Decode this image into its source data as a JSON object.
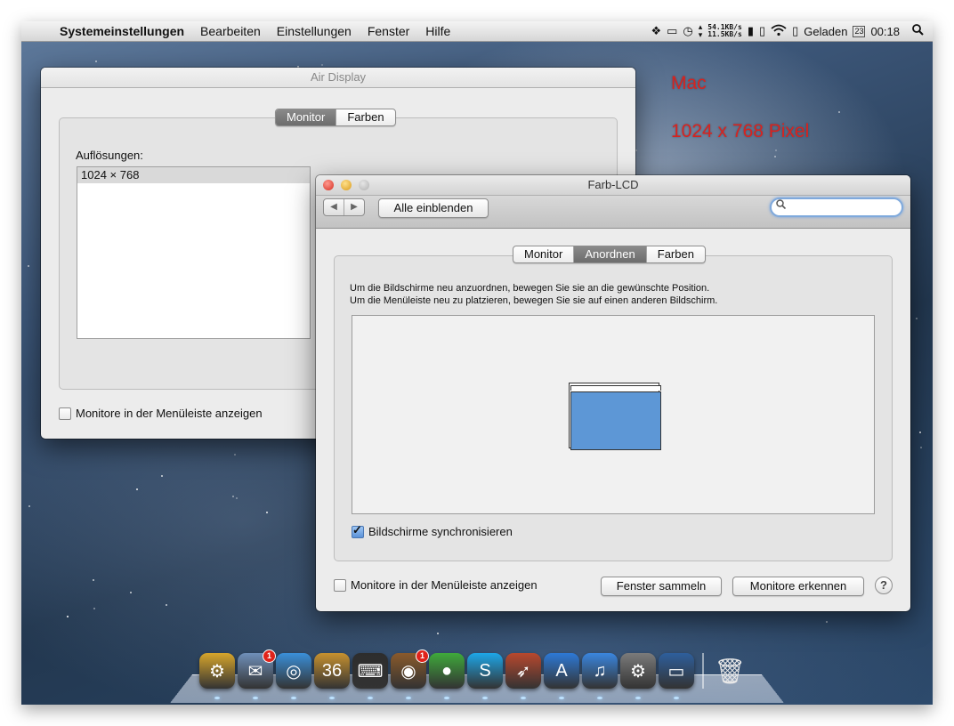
{
  "menubar": {
    "app_name": "Systemeinstellungen",
    "items": [
      "Bearbeiten",
      "Einstellungen",
      "Fenster",
      "Hilfe"
    ],
    "net_up": "54.1KB/s",
    "net_down": "11.5KB/s",
    "battery_label": "Geladen",
    "calendar_day": "23",
    "clock": "00:18",
    "status_icons": [
      "dropbox-icon",
      "airdisplay-icon",
      "timemachine-icon",
      "updown-icon",
      "memory-icon",
      "wifi-icon",
      "battery-icon",
      "spotlight-icon"
    ]
  },
  "desktop": {
    "label_mac": "Mac",
    "label_resolution": "1024 x 768 Pixel",
    "text_color": "#d8231f"
  },
  "air_display": {
    "title": "Air Display",
    "tabs": [
      "Monitor",
      "Farben"
    ],
    "selected_tab": "Monitor",
    "resolutions_label": "Auflösungen:",
    "resolutions": [
      "1024 × 768"
    ],
    "menubar_checkbox_label": "Monitore in der Menüleiste anzeigen"
  },
  "farb_lcd": {
    "title": "Farb-LCD",
    "show_all_label": "Alle einblenden",
    "search_placeholder": "",
    "tabs": [
      "Monitor",
      "Anordnen",
      "Farben"
    ],
    "selected_tab": "Anordnen",
    "instruction_1": "Um die Bildschirme neu anzuordnen, bewegen Sie sie an die gewünschte Position.",
    "instruction_2": "Um die Menüleiste neu zu platzieren, bewegen Sie sie auf einen anderen Bildschirm.",
    "sync_label": "Bildschirme synchronisieren",
    "sync_checked": true,
    "menubar_checkbox_label": "Monitore in der Menüleiste anzeigen",
    "gather_windows_label": "Fenster sammeln",
    "detect_displays_label": "Monitore erkennen",
    "help_label": "?"
  },
  "dock": {
    "items": [
      {
        "name": "forklift",
        "color": "#d7a52b",
        "glyph": "⚙"
      },
      {
        "name": "mail",
        "color": "#6f8fb9",
        "glyph": "✉",
        "badge": "1"
      },
      {
        "name": "safari",
        "color": "#3a8fd9",
        "glyph": "◎"
      },
      {
        "name": "calendar-box",
        "color": "#c7912f",
        "glyph": "36"
      },
      {
        "name": "console",
        "color": "#2d2d2d",
        "glyph": "⌨"
      },
      {
        "name": "owl",
        "color": "#8a5a2b",
        "glyph": "◉",
        "badge": "1"
      },
      {
        "name": "adium",
        "color": "#3fa93b",
        "glyph": "●"
      },
      {
        "name": "skype",
        "color": "#1da6e8",
        "glyph": "S"
      },
      {
        "name": "rocket",
        "color": "#b8482e",
        "glyph": "➶"
      },
      {
        "name": "app-store",
        "color": "#2d79d6",
        "glyph": "A"
      },
      {
        "name": "itunes",
        "color": "#3a86df",
        "glyph": "♫"
      },
      {
        "name": "system-preferences",
        "color": "#7b7b7b",
        "glyph": "⚙"
      },
      {
        "name": "air-display",
        "color": "#2e5f9c",
        "glyph": "▭"
      }
    ],
    "trash": {
      "name": "trash",
      "color": "#b9b9b9",
      "glyph": "🗑"
    }
  }
}
